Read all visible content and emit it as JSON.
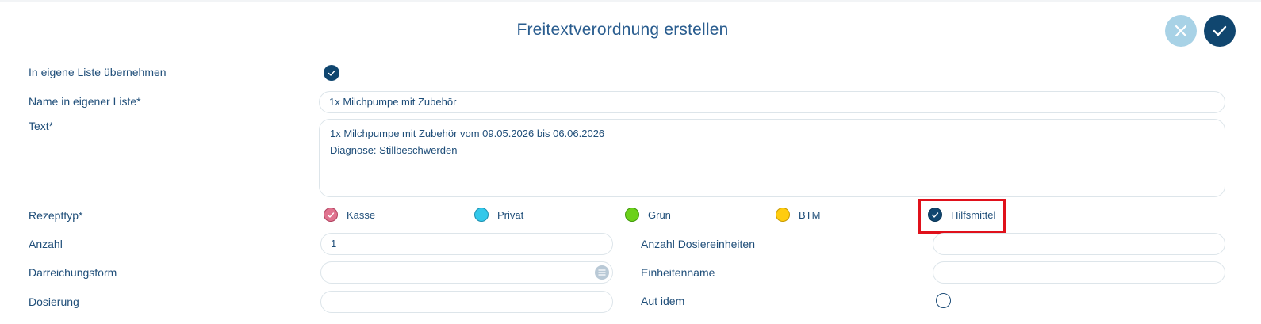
{
  "dialog": {
    "title": "Freitextverordnung erstellen",
    "cancel_icon": "close-icon",
    "confirm_icon": "check-icon"
  },
  "form": {
    "own_list_label": "In eigene Liste übernehmen",
    "own_list_checked": true,
    "name_label": "Name in eigener Liste*",
    "name_value": "1x Milchpumpe mit Zubehör",
    "text_label": "Text*",
    "text_lines": [
      "1x Milchpumpe mit Zubehör vom 09.05.2026 bis 06.06.2026",
      "Diagnose: Stillbeschwerden"
    ],
    "rezepttyp_label": "Rezepttyp*",
    "rezepttyp_options": [
      {
        "label": "Kasse",
        "color": "#e0738f",
        "checked": true
      },
      {
        "label": "Privat",
        "color": "#33c8ea",
        "checked": false
      },
      {
        "label": "Grün",
        "color": "#6cd11b",
        "checked": false
      },
      {
        "label": "BTM",
        "color": "#ffcc0f",
        "checked": false
      },
      {
        "label": "Hilfsmittel",
        "color": "#10466f",
        "checked": true
      }
    ],
    "anzahl_label": "Anzahl",
    "anzahl_value": "1",
    "darreichungsform_label": "Darreichungsform",
    "darreichungsform_value": "",
    "dosierung_label": "Dosierung",
    "dosierung_value": "",
    "anzahl_dosiereinheiten_label": "Anzahl Dosiereinheiten",
    "anzahl_dosiereinheiten_value": "",
    "einheitenname_label": "Einheitenname",
    "einheitenname_value": "",
    "aut_idem_label": "Aut idem",
    "aut_idem_checked": false
  },
  "colors": {
    "accent": "#10466f",
    "accent_light": "#a8d2e6",
    "highlight": "#e0111b"
  }
}
